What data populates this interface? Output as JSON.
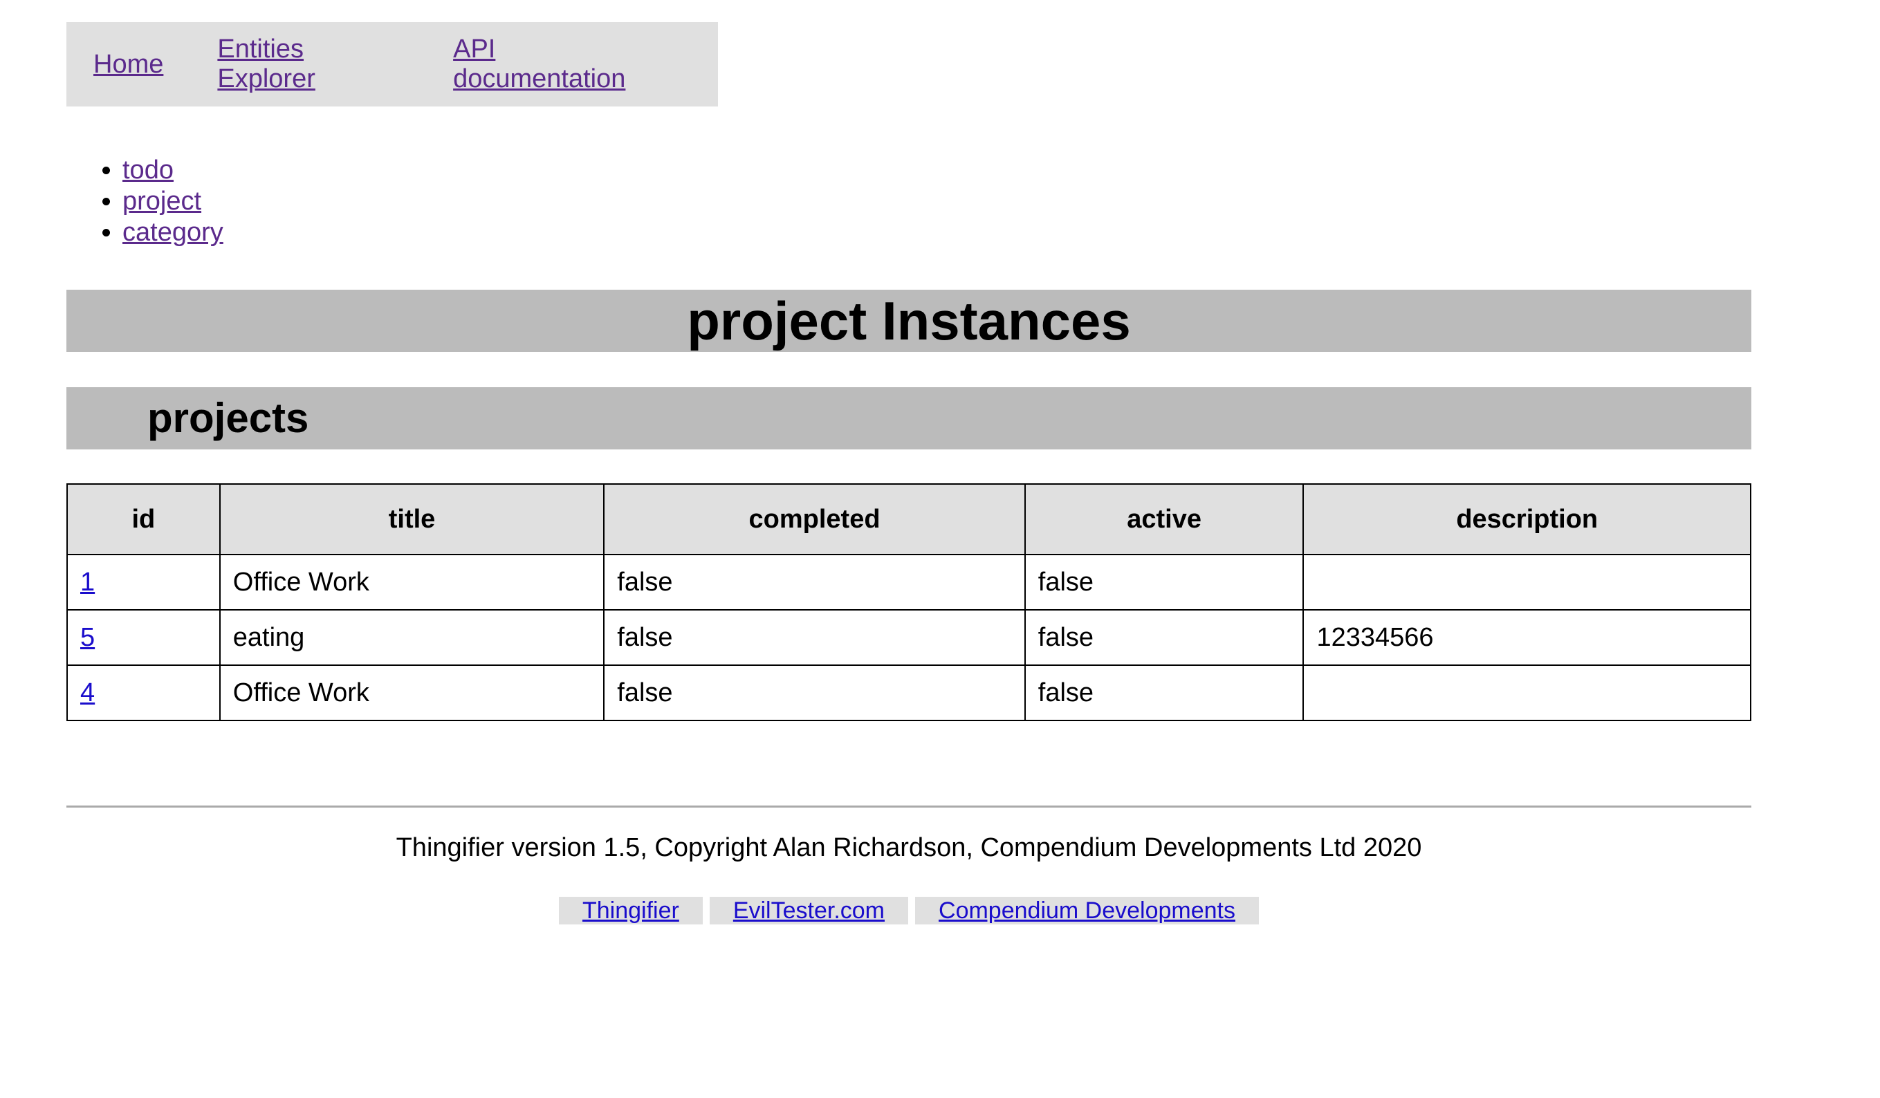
{
  "nav": {
    "links": [
      "Home",
      "Entities Explorer",
      "API documentation"
    ]
  },
  "entities": [
    "todo",
    "project",
    "category"
  ],
  "page_title": "project Instances",
  "section_title": "projects",
  "table": {
    "columns": [
      "id",
      "title",
      "completed",
      "active",
      "description"
    ],
    "rows": [
      {
        "id": "1",
        "title": "Office Work",
        "completed": "false",
        "active": "false",
        "description": ""
      },
      {
        "id": "5",
        "title": "eating",
        "completed": "false",
        "active": "false",
        "description": "12334566"
      },
      {
        "id": "4",
        "title": "Office Work",
        "completed": "false",
        "active": "false",
        "description": ""
      }
    ]
  },
  "footer": {
    "copyright": "Thingifier version 1.5, Copyright Alan Richardson, Compendium Developments Ltd 2020",
    "links": [
      "Thingifier",
      "EvilTester.com",
      "Compendium Developments"
    ]
  },
  "colors": {
    "visited_link": "#5b2a8c",
    "link": "#1a0dcc",
    "banner_bg": "#bbbbbb",
    "nav_bg": "#e0e0e0"
  }
}
